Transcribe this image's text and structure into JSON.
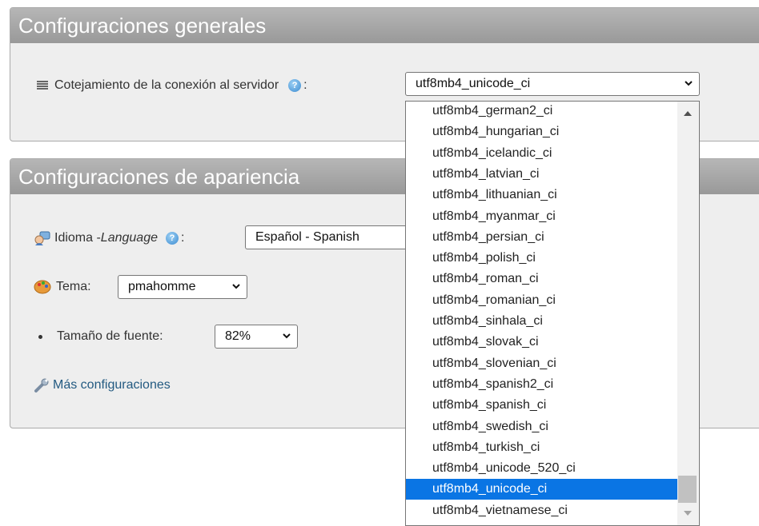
{
  "general": {
    "title": "Configuraciones generales",
    "collation_label": "Cotejamiento de la conexión al servidor",
    "help_icon": "help-icon",
    "colon": ":",
    "collation_value": "utf8mb4_unicode_ci"
  },
  "dropdown": {
    "options": [
      "utf8mb4_german2_ci",
      "utf8mb4_hungarian_ci",
      "utf8mb4_icelandic_ci",
      "utf8mb4_latvian_ci",
      "utf8mb4_lithuanian_ci",
      "utf8mb4_myanmar_ci",
      "utf8mb4_persian_ci",
      "utf8mb4_polish_ci",
      "utf8mb4_roman_ci",
      "utf8mb4_romanian_ci",
      "utf8mb4_sinhala_ci",
      "utf8mb4_slovak_ci",
      "utf8mb4_slovenian_ci",
      "utf8mb4_spanish2_ci",
      "utf8mb4_spanish_ci",
      "utf8mb4_swedish_ci",
      "utf8mb4_turkish_ci",
      "utf8mb4_unicode_520_ci",
      "utf8mb4_unicode_ci",
      "utf8mb4_vietnamese_ci"
    ],
    "selected": "utf8mb4_unicode_ci",
    "selection_color": "#0a75e4"
  },
  "appearance": {
    "title": "Configuraciones de apariencia",
    "language_label": "Idioma - ",
    "language_label_italic": "Language",
    "language_value": "Español - Spanish",
    "theme_label": "Tema:",
    "theme_value": "pmahomme",
    "font_size_label": "Tamaño de fuente:",
    "font_size_value": "82%",
    "more_settings": "Más configuraciones"
  },
  "colors": {
    "panel_header": "#a5a5a5",
    "panel_body": "#eeeeee",
    "link": "#235a81"
  }
}
